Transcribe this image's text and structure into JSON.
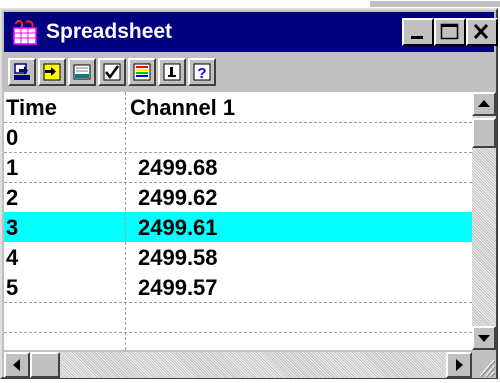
{
  "window": {
    "title": "Spreadsheet",
    "title_bar_color": "#000080"
  },
  "title_buttons": [
    "minimize-icon",
    "maximize-icon",
    "close-icon"
  ],
  "toolbar": {
    "tools": [
      "save-icon",
      "import-icon",
      "print-icon",
      "check-icon",
      "color-bars-icon",
      "info-icon",
      "help-icon"
    ],
    "help_glyph": "?"
  },
  "table": {
    "columns": [
      "Time",
      "Channel 1"
    ],
    "rows": [
      {
        "time": "0",
        "channel1": ""
      },
      {
        "time": "1",
        "channel1": "2499.68"
      },
      {
        "time": "2",
        "channel1": "2499.62"
      },
      {
        "time": "3",
        "channel1": "2499.61"
      },
      {
        "time": "4",
        "channel1": "2499.58"
      },
      {
        "time": "5",
        "channel1": "2499.57"
      }
    ],
    "selected_row_index": 3,
    "selection_color": "#00ffff"
  }
}
